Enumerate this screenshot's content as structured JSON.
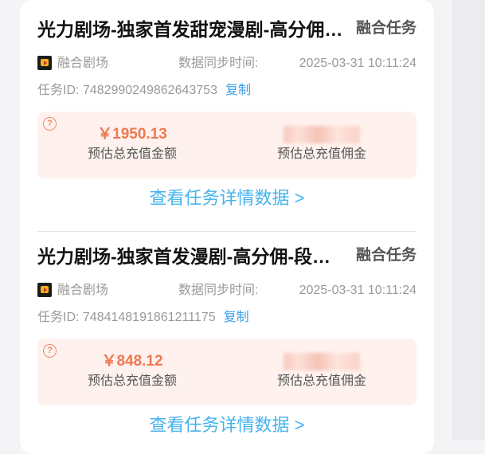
{
  "tasks": [
    {
      "title": "光力剧场-独家首发甜宠漫剧-高分佣-段",
      "type": "融合任务",
      "app_name": "融合剧场",
      "sync_label": "数据同步时间:",
      "sync_time": "2025-03-31 10:11:24",
      "task_id_label": "任务ID: 7482990249862643753",
      "copy_label": "复制",
      "help_glyph": "?",
      "recharge_value": "￥1950.13",
      "recharge_label": "预估总充值金额",
      "commission_label": "预估总充值佣金",
      "detail_link": "查看任务详情数据 >"
    },
    {
      "title": "光力剧场-独家首发漫剧-高分佣-段位任务",
      "type": "融合任务",
      "app_name": "融合剧场",
      "sync_label": "数据同步时间:",
      "sync_time": "2025-03-31 10:11:24",
      "task_id_label": "任务ID: 7484148191861211175",
      "copy_label": "复制",
      "help_glyph": "?",
      "recharge_value": "￥848.12",
      "recharge_label": "预估总充值金额",
      "commission_label": "预估总充值佣金",
      "detail_link": "查看任务详情数据 >"
    }
  ],
  "colors": {
    "accent_link": "#45b3ee",
    "amount": "#f07850",
    "stat_bg": "#fff2ee"
  }
}
